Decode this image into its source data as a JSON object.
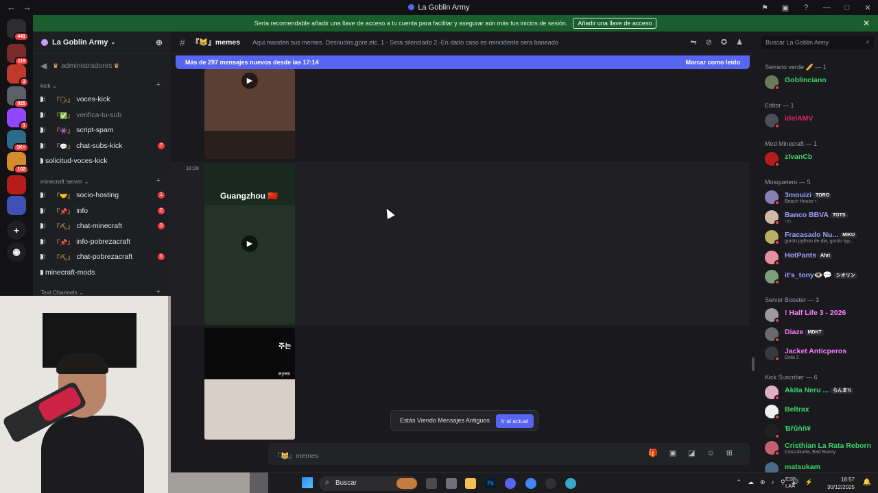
{
  "window": {
    "title": "La Goblin Army"
  },
  "colors": {
    "brand": "#5865f2",
    "banner": "#1a5e2e",
    "mention": "#f23f43",
    "online": "#23a55a"
  },
  "servers": [
    {
      "name": "discord-home-icon",
      "badge": "441",
      "color": "#2b2d31"
    },
    {
      "name": "server-1",
      "badge": "119",
      "color": "#7a2a2a"
    },
    {
      "name": "server-2",
      "badge": "3",
      "color": "#c0392b"
    },
    {
      "name": "server-3",
      "badge": "925",
      "color": "#5b5f66"
    },
    {
      "name": "twitch-server",
      "badge": "1",
      "color": "#9146ff"
    },
    {
      "name": "server-5",
      "badge": "1K+",
      "color": "#2d6a8a"
    },
    {
      "name": "server-6",
      "badge": "102",
      "color": "#d38b2b"
    },
    {
      "name": "server-7",
      "badge": "",
      "color": "#b71c1c"
    },
    {
      "name": "server-8",
      "badge": "",
      "color": "#3f51b5"
    }
  ],
  "banner": {
    "text": "Sería recomendable añadir una llave de acceso a tu cuenta para facilitar y asegurar aún más tus inicios de sesión.",
    "button": "Añadir una llave de acceso"
  },
  "sidebar": {
    "guild_name": "La Goblin Army",
    "pinned": "administradores",
    "categories": [
      {
        "label": "kick"
      },
      {
        "label": "minecraft server"
      },
      {
        "label": "Text Channels"
      }
    ],
    "channels": [
      {
        "label": "voces-kick",
        "emoji": "『🗣』",
        "badge": ""
      },
      {
        "label": "verifica-tu-sub",
        "emoji": "『✅』",
        "badge": ""
      },
      {
        "label": "script-spam",
        "emoji": "『👾』",
        "badge": ""
      },
      {
        "label": "chat-subs-kick",
        "emoji": "『💬』",
        "badge": "7"
      },
      {
        "label": "solicitud-voces-kick",
        "emoji": "",
        "badge": ""
      },
      {
        "label": "socio-hosting",
        "emoji": "『🤝』",
        "badge": "1"
      },
      {
        "label": "info",
        "emoji": "『📌』",
        "badge": "2"
      },
      {
        "label": "chat-minecraft",
        "emoji": "『⛏』",
        "badge": "3"
      },
      {
        "label": "info-pobrezacraft",
        "emoji": "『📌』",
        "badge": ""
      },
      {
        "label": "chat-pobrezacraft",
        "emoji": "『⛏』",
        "badge": "1"
      },
      {
        "label": "minecraft-mods",
        "emoji": "",
        "badge": ""
      }
    ]
  },
  "chat": {
    "channel_name": "『😹』memes",
    "topic": "Aqui manden sus memes. Desnudos,gore,etc. 1.- Sera silenciado 2.-En dado caso es reincidente sera baneado",
    "new_messages": "Más de 297 mensajes nuevos desde las 17:14",
    "mark_read": "Marcar como leído",
    "timestamp": "18:28",
    "video_caption": "Guangzhou 🇨🇳",
    "video3_caption": "eyes",
    "video3_caption2": "주는",
    "notice": "Estás Viendo Mensajes Antiguos",
    "jump": "Ir al actual",
    "input_placeholder": "『😹』memes"
  },
  "search": {
    "placeholder": "Buscar La Goblin Army"
  },
  "members": {
    "roles": [
      {
        "label": "Serrano verde 🥖 — 1"
      },
      {
        "label": "Editor — 1"
      },
      {
        "label": "Mod Minecraft — 1"
      },
      {
        "label": "Mosquetero — 5"
      },
      {
        "label": "Server Booster — 3"
      },
      {
        "label": "Kick Suscriber — 6"
      }
    ],
    "list": [
      {
        "name": "Goblinciano",
        "color": "#3ed16a",
        "sub": "",
        "tag": "",
        "av": "#6b7b5a"
      },
      {
        "name": "idelAMV",
        "color": "#e0245e",
        "sub": "",
        "tag": "",
        "av": "#4a4e58"
      },
      {
        "name": "zIvanCb",
        "color": "#3ed16a",
        "sub": "",
        "tag": "",
        "av": "#b71c1c"
      },
      {
        "name": "3mouizi",
        "color": "#a29bfe",
        "sub": "Beach House •",
        "tag": "TORO",
        "av": "#8a7fb3"
      },
      {
        "name": "Banco BBVA",
        "color": "#a29bfe",
        "sub": "↑z↓",
        "tag": "TOTS",
        "av": "#d4b8a6"
      },
      {
        "name": "Fracasado Nu...",
        "color": "#a29bfe",
        "sub": "gordo python de dia, gordo typ...",
        "tag": "MIKU",
        "av": "#b8b064"
      },
      {
        "name": "HotPants",
        "color": "#a29bfe",
        "sub": "",
        "tag": "Ahri",
        "av": "#e68fa0"
      },
      {
        "name": "it's_tony👁️💬",
        "color": "#a29bfe",
        "sub": "",
        "tag": "シオリン",
        "av": "#7ca07a"
      },
      {
        "name": "! Half Life 3 - 2026",
        "color": "#f47fff",
        "sub": "",
        "tag": "",
        "av": "#9a9aa0"
      },
      {
        "name": "Diaze",
        "color": "#f47fff",
        "sub": "",
        "tag": "MDKT",
        "av": "#6a6a6a"
      },
      {
        "name": "Jacket Anticperos",
        "color": "#f47fff",
        "sub": "Dota 2",
        "tag": "",
        "av": "#3a3a3a"
      },
      {
        "name": "Akita Neru ...",
        "color": "#3ed16a",
        "sub": "",
        "tag": "らんま½",
        "av": "#e0b0c0"
      },
      {
        "name": "Beltrax",
        "color": "#3ed16a",
        "sub": "",
        "tag": "",
        "av": "#f0f0f0"
      },
      {
        "name": "Ɓřůňň¥",
        "color": "#3ed16a",
        "sub": "",
        "tag": "",
        "av": "#202020"
      },
      {
        "name": "Cristhian La Rata Reborn",
        "color": "#3ed16a",
        "sub": "Cosculluela, Bad Bunny",
        "tag": "",
        "av": "#c06070"
      },
      {
        "name": "matsukam",
        "color": "#3ed16a",
        "sub": "",
        "tag": "",
        "av": "#4a6a8a"
      }
    ]
  },
  "taskbar": {
    "search": "Buscar",
    "lang1": "ESP",
    "lang2": "LAA",
    "time": "18:57",
    "date": "30/12/2025"
  }
}
